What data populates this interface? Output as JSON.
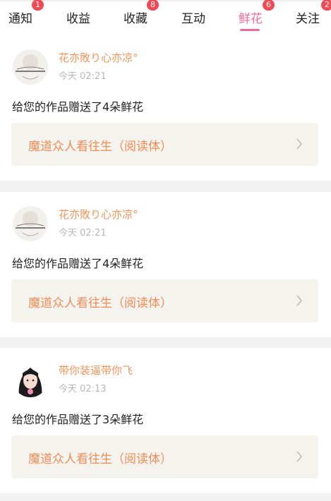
{
  "tabs": [
    {
      "label": "通知",
      "badge": "1",
      "active": false
    },
    {
      "label": "收益",
      "badge": "",
      "active": false
    },
    {
      "label": "收藏",
      "badge": "8",
      "active": false
    },
    {
      "label": "互动",
      "badge": "",
      "active": false
    },
    {
      "label": "鲜花",
      "badge": "6",
      "active": true
    },
    {
      "label": "关注",
      "badge": "2",
      "active": false
    }
  ],
  "colors": {
    "accent": "#f06a95",
    "username": "#f0955a",
    "work_title": "#f08c56",
    "badge": "#f04a55"
  },
  "notifications": [
    {
      "avatar_icon": "avatar-sketch-icon",
      "username": "花亦敗り心亦凉°",
      "time": "今天 02:21",
      "message": "给您的作品赠送了4朵鲜花",
      "work_title": "魔道众人看往生（阅读体）"
    },
    {
      "avatar_icon": "avatar-sketch-icon",
      "username": "花亦敗り心亦凉°",
      "time": "今天 02:21",
      "message": "给您的作品赠送了4朵鲜花",
      "work_title": "魔道众人看往生（阅读体）"
    },
    {
      "avatar_icon": "avatar-girl-icon",
      "username": "带你装逼带你飞",
      "time": "今天 02:13",
      "message": "给您的作品赠送了3朵鲜花",
      "work_title": "魔道众人看往生（阅读体）"
    }
  ]
}
